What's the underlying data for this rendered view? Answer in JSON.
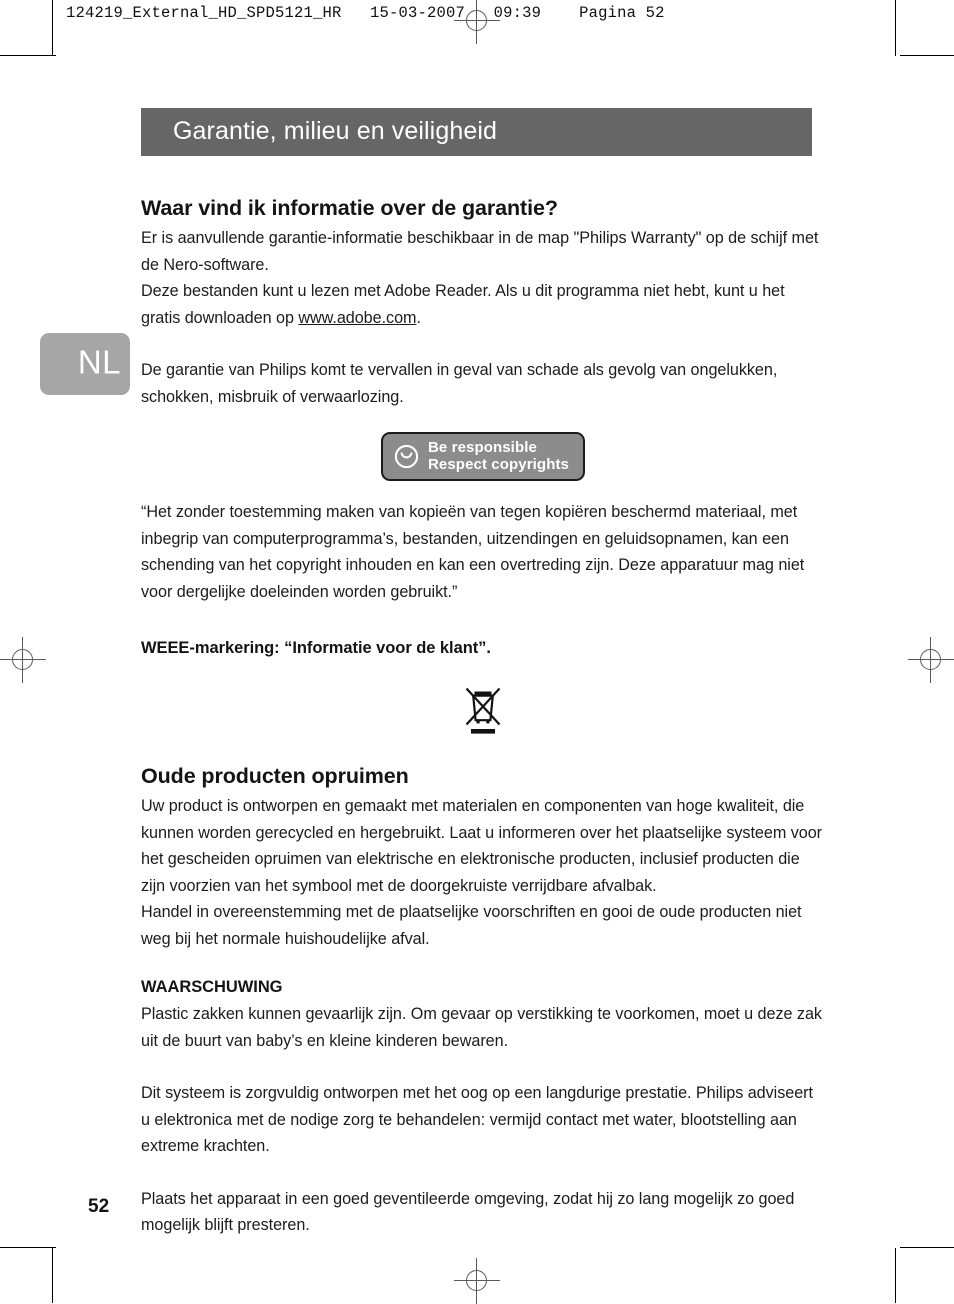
{
  "prepress": {
    "slugline": "124219_External_HD_SPD5121_HR   15-03-2007   09:39    Pagina 52",
    "colors": {
      "chapter_bar": "#666666",
      "lang_badge": "#a6a6a6",
      "copyright_badge_fill": "#8c8c8c",
      "text": "#1c1c1c"
    }
  },
  "chapter": {
    "title": "Garantie, milieu en veiligheid"
  },
  "language_badge": {
    "code": "NL"
  },
  "sections": {
    "warranty": {
      "heading": "Waar vind ik informatie over de garantie?",
      "para1": "Er is aanvullende garantie-informatie beschikbaar in de map \"Philips Warranty\" op de schijf met de Nero-software.",
      "para2_before_link": "Deze bestanden kunt u lezen met Adobe Reader. Als u dit programma niet hebt, kunt u het gratis downloaden op ",
      "link_text": "www.adobe.com",
      "para2_after_link": ".",
      "para3": "De garantie van Philips komt te vervallen in geval van schade als gevolg van ongelukken, schokken, misbruik of verwaarlozing."
    },
    "copyright_badge": {
      "line1": "Be responsible",
      "line2": "Respect copyrights",
      "icon": "copyright-circle-icon"
    },
    "copyright_notice": {
      "text": "“Het zonder toestemming maken van kopieën van tegen kopiëren beschermd materiaal, met inbegrip van computerprogramma’s, bestanden, uitzendingen en geluidsopnamen, kan een schending van het copyright inhouden en kan een overtreding zijn. Deze apparatuur mag niet voor dergelijke doeleinden worden gebruikt.”"
    },
    "weee": {
      "heading": "WEEE-markering: “Informatie voor de klant”.",
      "icon": "crossed-out-wheelie-bin-icon"
    },
    "disposal": {
      "heading": "Oude producten opruimen",
      "para1": "Uw product is ontworpen en gemaakt met materialen en componenten van hoge kwaliteit, die kunnen worden gerecycled en hergebruikt. Laat u informeren over het plaatselijke systeem voor het gescheiden opruimen van elektrische en elektronische producten, inclusief producten die zijn voorzien van het symbool met de doorgekruiste verrijdbare afvalbak.",
      "para2": "Handel in overeenstemming met de plaatselijke voorschriften en gooi de oude producten niet weg bij het normale huishoudelijke afval."
    },
    "warning": {
      "heading": "WAARSCHUWING",
      "para1": "Plastic zakken kunnen gevaarlijk zijn. Om gevaar op verstikking te voorkomen, moet u deze zak uit de buurt van baby’s en kleine kinderen bewaren.",
      "para2": "Dit systeem is zorgvuldig ontworpen met het oog op een langdurige prestatie. Philips adviseert u elektronica met de nodige zorg te behandelen: vermijd contact met water, blootstelling aan extreme krachten.",
      "para3": "Plaats het apparaat in een goed geventileerde omgeving, zodat hij zo lang mogelijk zo goed mogelijk blijft presteren."
    }
  },
  "footer": {
    "page_number": "52"
  }
}
